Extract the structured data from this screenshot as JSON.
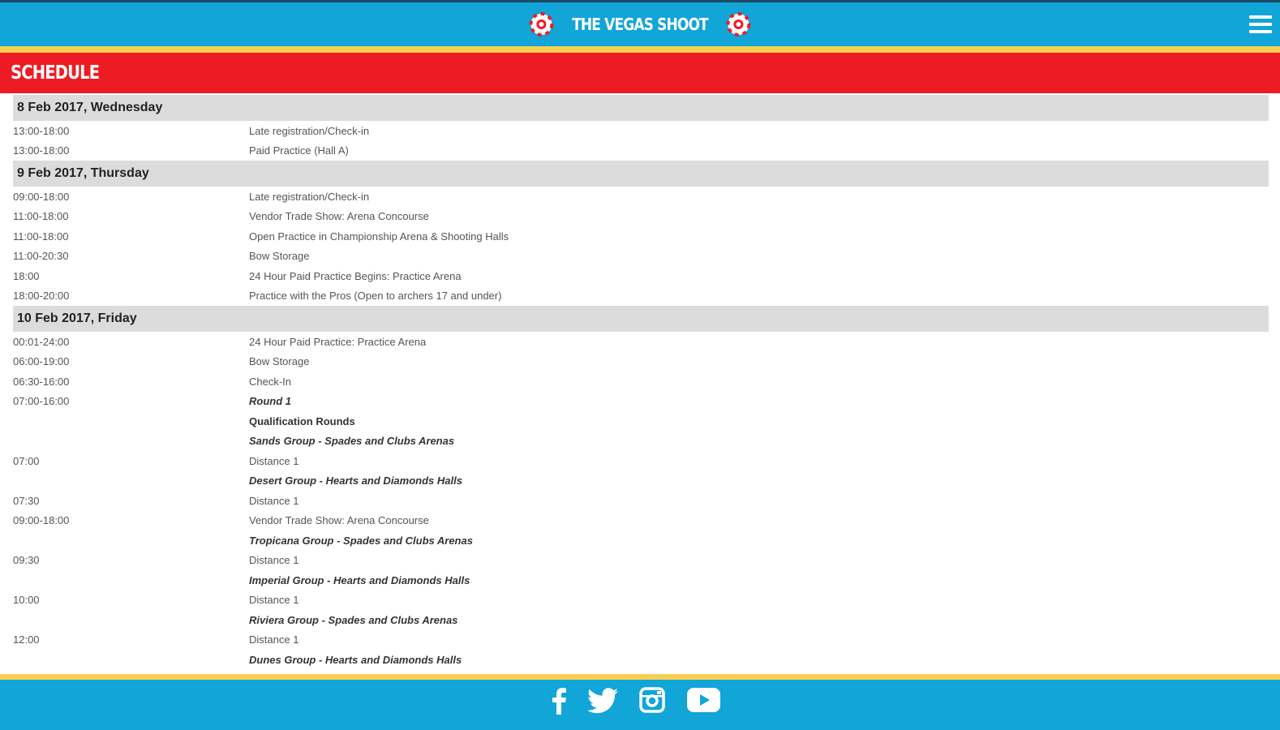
{
  "header": {
    "logo_text": "THE VEGAS SHOOT",
    "colors": {
      "header_bg": "#11a5d8",
      "stripe": "#f7cf52",
      "title_bar": "#ed1c24"
    }
  },
  "page": {
    "title": "SCHEDULE"
  },
  "schedule": {
    "days": [
      {
        "date": "8 Feb 2017, Wednesday",
        "events": [
          {
            "time": "13:00-18:00",
            "event": "Late registration/Check-in",
            "style": ""
          },
          {
            "time": "13:00-18:00",
            "event": "Paid Practice (Hall A)",
            "style": ""
          }
        ]
      },
      {
        "date": "9 Feb 2017, Thursday",
        "events": [
          {
            "time": "09:00-18:00",
            "event": "Late registration/Check-in",
            "style": ""
          },
          {
            "time": "11:00-18:00",
            "event": "Vendor Trade Show: Arena Concourse",
            "style": ""
          },
          {
            "time": "11:00-18:00",
            "event": "Open Practice in Championship Arena & Shooting Halls",
            "style": ""
          },
          {
            "time": "11:00-20:30",
            "event": "Bow Storage",
            "style": ""
          },
          {
            "time": "18:00",
            "event": "24 Hour Paid Practice Begins: Practice Arena",
            "style": ""
          },
          {
            "time": "18:00-20:00",
            "event": "Practice with the Pros (Open to archers 17 and under)",
            "style": ""
          }
        ]
      },
      {
        "date": "10 Feb 2017, Friday",
        "events": [
          {
            "time": "00:01-24:00",
            "event": "24 Hour Paid Practice: Practice Arena",
            "style": ""
          },
          {
            "time": "06:00-19:00",
            "event": "Bow Storage",
            "style": ""
          },
          {
            "time": "06:30-16:00",
            "event": "Check-In",
            "style": ""
          },
          {
            "time": "07:00-16:00",
            "event": "Round 1",
            "style": "bi"
          },
          {
            "time": "",
            "event": "Qualification Rounds",
            "style": "b"
          },
          {
            "time": "",
            "event": "Sands Group - Spades and Clubs Arenas",
            "style": "bi"
          },
          {
            "time": "07:00",
            "event": "Distance 1",
            "style": ""
          },
          {
            "time": "",
            "event": "Desert Group - Hearts and Diamonds Halls",
            "style": "bi"
          },
          {
            "time": "07:30",
            "event": "Distance 1",
            "style": ""
          },
          {
            "time": "09:00-18:00",
            "event": "Vendor Trade Show: Arena Concourse",
            "style": ""
          },
          {
            "time": "",
            "event": "Tropicana Group - Spades and Clubs Arenas",
            "style": "bi"
          },
          {
            "time": "09:30",
            "event": "Distance 1",
            "style": ""
          },
          {
            "time": "",
            "event": "Imperial Group - Hearts and Diamonds Halls",
            "style": "bi"
          },
          {
            "time": "10:00",
            "event": "Distance 1",
            "style": ""
          },
          {
            "time": "",
            "event": "Riviera Group - Spades and Clubs Arenas",
            "style": "bi"
          },
          {
            "time": "12:00",
            "event": "Distance 1",
            "style": ""
          },
          {
            "time": "",
            "event": "Dunes Group - Hearts and Diamonds Halls",
            "style": "bi"
          }
        ]
      }
    ]
  },
  "footer": {
    "icons": [
      "facebook-icon",
      "twitter-icon",
      "instagram-icon",
      "youtube-icon"
    ]
  }
}
